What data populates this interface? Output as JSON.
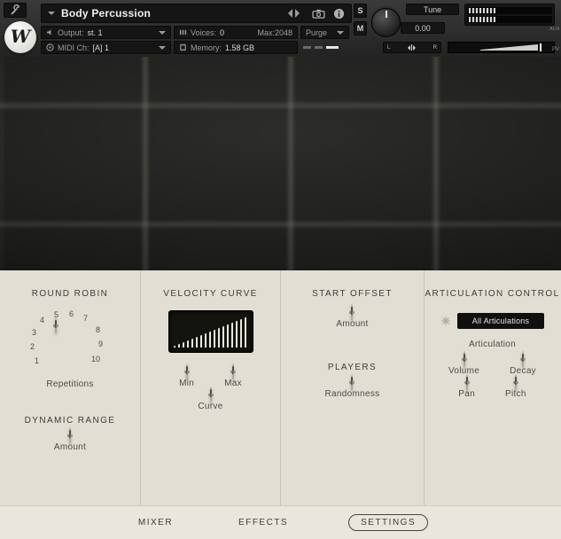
{
  "colors": {
    "panel_bg": "#e2ded4",
    "header_bg": "#2b2b2b",
    "display_bg": "#14140f",
    "text_dark": "#3c3c37",
    "accent_light": "#e9e7de"
  },
  "header": {
    "logo_letter": "W",
    "title": "Body Percussion",
    "output_label": "Output:",
    "output_value": "st. 1",
    "voices_label": "Voices:",
    "voices_value": "0",
    "max_label": "Max:2048",
    "purge_label": "Purge",
    "midi_label": "MIDI Ch:",
    "midi_value": "[A] 1",
    "memory_label": "Memory:",
    "memory_value": "1.58 GB",
    "tune_label": "Tune",
    "tune_value": "0.00",
    "solo_label": "S",
    "mute_label": "M",
    "pan_left": "L",
    "pan_right": "R",
    "aux_label": "AUX",
    "pv_label": "PV"
  },
  "panel": {
    "round_robin": {
      "title": "ROUND ROBIN",
      "numbers": [
        "1",
        "2",
        "3",
        "4",
        "5",
        "6",
        "7",
        "8",
        "9",
        "10"
      ],
      "repetitions_label": "Repetitions",
      "dynamic_range_title": "DYNAMIC RANGE",
      "amount_label": "Amount"
    },
    "velocity_curve": {
      "title": "VELOCITY CURVE",
      "min_label": "Min",
      "max_label": "Max",
      "curve_label": "Curve"
    },
    "start_offset": {
      "title": "START OFFSET",
      "amount_label": "Amount",
      "players_title": "PLAYERS",
      "randomness_label": "Randomness"
    },
    "articulation": {
      "title": "ARTICULATION CONTROL",
      "dropdown_value": "All Articulations",
      "articulation_label": "Articulation",
      "volume_label": "Volume",
      "decay_label": "Decay",
      "pan_label": "Pan",
      "pitch_label": "Pitch"
    }
  },
  "tabs": [
    {
      "label": "MIXER"
    },
    {
      "label": "EFFECTS"
    },
    {
      "label": "SETTINGS"
    }
  ]
}
